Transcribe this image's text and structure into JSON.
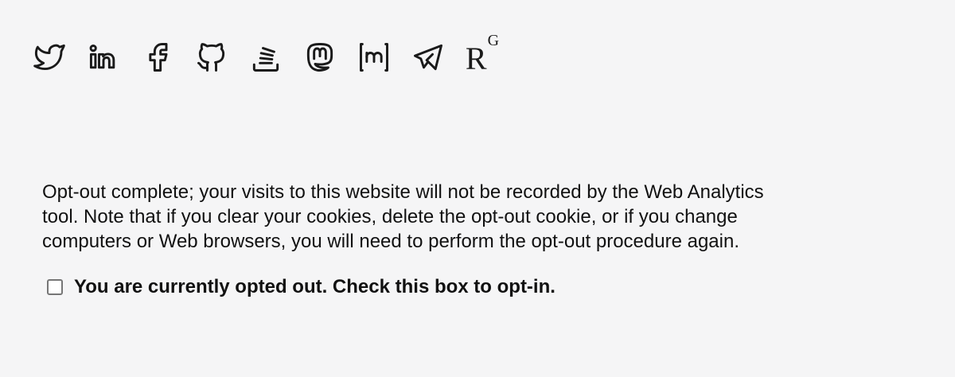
{
  "social_links": [
    {
      "icon": "twitter-icon"
    },
    {
      "icon": "linkedin-icon"
    },
    {
      "icon": "facebook-icon"
    },
    {
      "icon": "github-icon"
    },
    {
      "icon": "stackoverflow-icon"
    },
    {
      "icon": "mastodon-icon"
    },
    {
      "icon": "matrix-icon"
    },
    {
      "icon": "telegram-icon"
    },
    {
      "icon": "researchgate-icon",
      "logo_text": "R",
      "logo_sup": "G"
    }
  ],
  "optout": {
    "message": "Opt-out complete; your visits to this website will not be recorded by the Web Analytics tool. Note that if you clear your cookies, delete the opt-out cookie, or if you change computers or Web browsers, you will need to perform the opt-out procedure again.",
    "checkbox_checked": false,
    "checkbox_label": "You are currently opted out. Check this box to opt-in."
  }
}
